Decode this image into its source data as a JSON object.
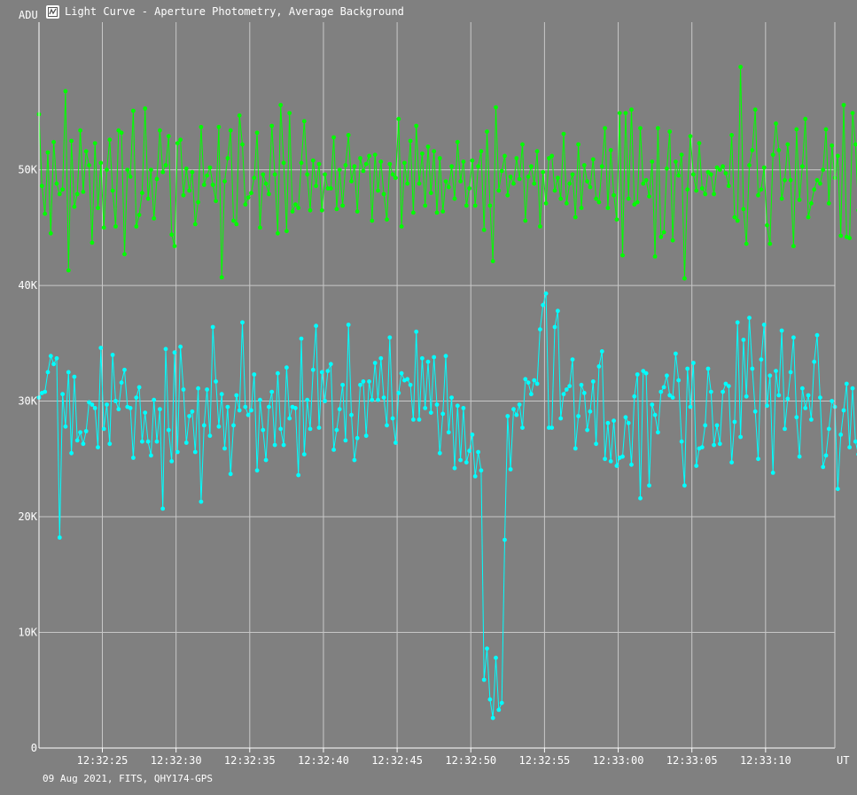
{
  "window": {
    "title": "Light Curve - Aperture Photometry, Average Background",
    "icon": "light-curve-app-icon"
  },
  "footer": {
    "info": "09 Aug 2021, FITS, QHY174-GPS"
  },
  "chart_data": {
    "type": "line",
    "ylabel": "ADU",
    "xlabel": "UT",
    "ylim": [
      0,
      62000
    ],
    "y_ticks": [
      0,
      10000,
      20000,
      30000,
      40000,
      50000
    ],
    "y_tick_labels": [
      "0",
      "10K",
      "20K",
      "30K",
      "40K",
      "50K"
    ],
    "x_range_seconds": [
      20.7,
      74.7
    ],
    "x_ticks": [
      25,
      30,
      35,
      40,
      45,
      50,
      55,
      60,
      65,
      70
    ],
    "x_tick_labels": [
      "12:32:25",
      "12:32:30",
      "12:32:35",
      "12:32:40",
      "12:32:45",
      "12:32:50",
      "12:32:55",
      "12:33:00",
      "12:33:05",
      "12:33:10"
    ],
    "x_time_origin": "12:32:00",
    "x_step_seconds": 0.2,
    "grid": true,
    "series": [
      {
        "color": "#00ff00",
        "x_start_seconds": 20.7,
        "values": [
          54800,
          48600,
          46200,
          51500,
          44500,
          52400,
          48800,
          47900,
          48300,
          56800,
          41300,
          52500,
          46800,
          47900,
          53400,
          48100,
          51600,
          50400,
          43700,
          52300,
          46700,
          50600,
          45000,
          50000,
          52600,
          48200,
          45100,
          53400,
          53200,
          42700,
          50000,
          49400,
          55100,
          45100,
          46100,
          48000,
          55300,
          47500,
          50000,
          45800,
          49200,
          53400,
          49800,
          50400,
          52900,
          44400,
          43400,
          52300,
          52600,
          47800,
          50100,
          48200,
          49800,
          45300,
          47200,
          53700,
          48700,
          49500,
          50200,
          48700,
          47300,
          53700,
          40700,
          49000,
          51000,
          53400,
          45600,
          45300,
          54700,
          52200,
          47000,
          47600,
          48000,
          49300,
          53200,
          45000,
          49600,
          48800,
          47900,
          53800,
          49600,
          44500,
          55600,
          50600,
          44700,
          54900,
          46400,
          47000,
          46700,
          50600,
          54200,
          49600,
          46500,
          50800,
          48600,
          50500,
          46500,
          49600,
          48400,
          48400,
          52800,
          46600,
          50000,
          46900,
          50400,
          53000,
          49000,
          50300,
          46400,
          51000,
          49900,
          50500,
          51200,
          45600,
          51300,
          48200,
          50700,
          47900,
          45700,
          50500,
          49600,
          49300,
          54400,
          45100,
          50600,
          48800,
          52500,
          46300,
          53800,
          48800,
          51400,
          46900,
          52000,
          48000,
          51600,
          46300,
          51000,
          46400,
          49000,
          48500,
          50300,
          47500,
          52400,
          49000,
          50700,
          46900,
          48400,
          50800,
          46900,
          50300,
          51600,
          44800,
          53300,
          46900,
          42100,
          55400,
          48200,
          49900,
          51200,
          47800,
          49400,
          48800,
          51000,
          49200,
          52200,
          45600,
          49400,
          50300,
          48800,
          51600,
          45100,
          49800,
          47100,
          51000,
          51200,
          48200,
          49300,
          47500,
          53100,
          47100,
          48800,
          49600,
          45900,
          52200,
          46700,
          50400,
          49000,
          48500,
          50900,
          47500,
          47200,
          50300,
          53600,
          46700,
          51700,
          47800,
          45700,
          54900,
          42600,
          54900,
          47500,
          55200,
          47000,
          47200,
          53600,
          48800,
          49100,
          47700,
          50700,
          42500,
          53600,
          44200,
          44600,
          50100,
          53300,
          43900,
          50700,
          49500,
          51300,
          40600,
          48300,
          52900,
          49600,
          48200,
          52300,
          48400,
          47900,
          49800,
          49600,
          47900,
          50200,
          50000,
          50300,
          49700,
          48600,
          53000,
          45900,
          45600,
          58900,
          46600,
          43600,
          50400,
          51700,
          55200,
          47800,
          48300,
          50200,
          45200,
          43600,
          51300,
          54000,
          51700,
          47500,
          49100,
          52200,
          49100,
          43400,
          53500,
          47400,
          50300,
          54400,
          45900,
          47100,
          48300,
          49100,
          48800,
          50000,
          53500,
          47100,
          52100,
          49300,
          51200,
          44300,
          55600,
          44200,
          44100,
          54900,
          52200,
          46500,
          47600
        ]
      },
      {
        "color": "#00ffff",
        "x_start_seconds": 20.7,
        "values": [
          30300,
          30700,
          30800,
          32500,
          33900,
          33200,
          33700,
          18200,
          30600,
          27800,
          32500,
          25500,
          32100,
          26600,
          27300,
          26300,
          27400,
          29900,
          29700,
          29400,
          26000,
          34600,
          27600,
          29700,
          26300,
          34000,
          30000,
          29300,
          31600,
          32700,
          29500,
          29400,
          25100,
          30300,
          31200,
          26500,
          29000,
          26500,
          25300,
          30100,
          26500,
          29300,
          20700,
          34500,
          27500,
          24800,
          34200,
          25600,
          34700,
          31000,
          26400,
          28700,
          29100,
          25600,
          31100,
          21300,
          27900,
          31000,
          27000,
          36400,
          31700,
          27800,
          30600,
          25900,
          29500,
          23700,
          27900,
          30500,
          29200,
          36800,
          29500,
          28800,
          29200,
          32300,
          24000,
          30100,
          27500,
          24900,
          29500,
          30800,
          26200,
          32400,
          27600,
          26200,
          32900,
          28500,
          29500,
          29400,
          23600,
          35400,
          25400,
          30100,
          27600,
          32700,
          36500,
          27700,
          32500,
          30000,
          32600,
          33200,
          25800,
          27500,
          29300,
          31400,
          26600,
          36600,
          28800,
          24900,
          26800,
          31400,
          31700,
          27000,
          31700,
          30100,
          33300,
          30100,
          33700,
          30300,
          27900,
          35500,
          28500,
          26400,
          30700,
          32400,
          31800,
          31900,
          31400,
          28400,
          36000,
          28400,
          33700,
          29400,
          33400,
          29000,
          33800,
          29700,
          25500,
          28900,
          33900,
          27300,
          30300,
          24200,
          29600,
          24900,
          29400,
          24700,
          25700,
          27100,
          23500,
          25600,
          24000,
          5900,
          8600,
          4200,
          2600,
          7800,
          3300,
          3900,
          18000,
          28700,
          24100,
          29300,
          28800,
          29700,
          27700,
          31900,
          31600,
          30600,
          31800,
          31500,
          36200,
          38300,
          39300,
          27700,
          27700,
          36400,
          37800,
          28500,
          30600,
          31000,
          31300,
          33600,
          25900,
          28700,
          31400,
          30700,
          27500,
          29100,
          31700,
          26300,
          33000,
          34300,
          25000,
          28100,
          24800,
          28300,
          24400,
          25100,
          25200,
          28600,
          28100,
          24500,
          30400,
          32300,
          21600,
          32600,
          32400,
          22700,
          29700,
          28800,
          27300,
          30800,
          31200,
          32200,
          30500,
          30300,
          34100,
          31800,
          26500,
          22700,
          32800,
          29500,
          33300,
          24400,
          25900,
          26000,
          27900,
          32800,
          30800,
          26200,
          27900,
          26300,
          30800,
          31500,
          31300,
          24700,
          28200,
          36800,
          26900,
          35300,
          30400,
          37200,
          32800,
          29100,
          25000,
          33600,
          36600,
          29600,
          32200,
          23800,
          32600,
          30500,
          36100,
          27600,
          30200,
          32500,
          35500,
          28600,
          25200,
          31100,
          29400,
          30500,
          28400,
          33400,
          35700,
          30300,
          24300,
          25300,
          27600,
          30000,
          29500,
          22400,
          27100,
          29200,
          31500,
          26000,
          31100,
          26500,
          25400,
          31000,
          30700,
          28400,
          30500,
          28800,
          27200,
          30400
        ]
      }
    ]
  }
}
